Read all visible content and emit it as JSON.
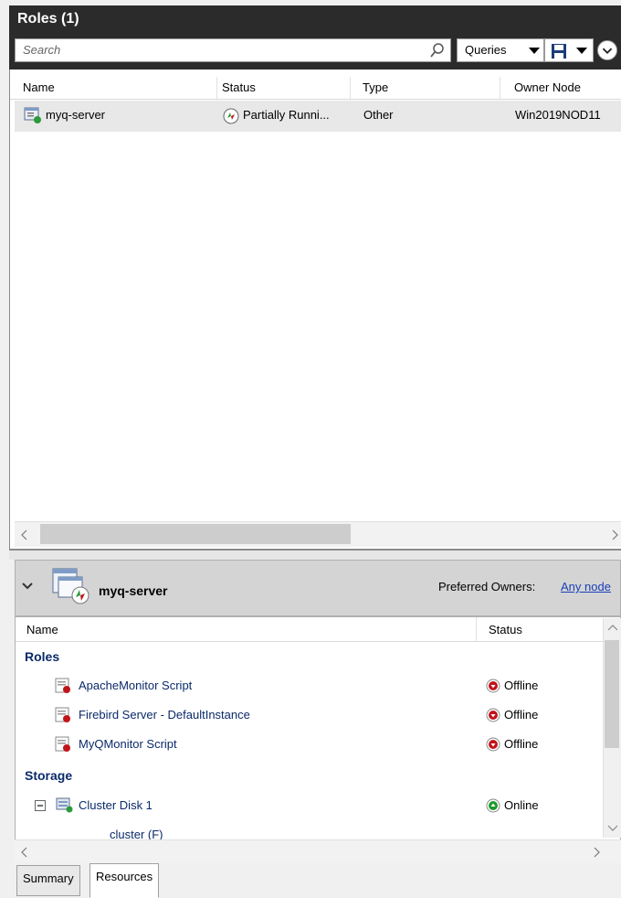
{
  "pane": {
    "title": "Roles (1)"
  },
  "search": {
    "placeholder": "Search"
  },
  "toolbar": {
    "queries_label": "Queries"
  },
  "roles_table": {
    "columns": [
      "Name",
      "Status",
      "Type",
      "Owner Node"
    ],
    "rows": [
      {
        "name": "myq-server",
        "status": "Partially Runni...",
        "type": "Other",
        "owner_node": "Win2019NOD11"
      }
    ]
  },
  "details": {
    "title": "myq-server",
    "preferred_owners_label": "Preferred Owners:",
    "preferred_owners_value": "Any node",
    "columns": [
      "Name",
      "Status"
    ],
    "groups": [
      {
        "label": "Roles",
        "items": [
          {
            "name": "ApacheMonitor Script",
            "status": "Offline"
          },
          {
            "name": "Firebird Server - DefaultInstance",
            "status": "Offline"
          },
          {
            "name": "MyQMonitor Script",
            "status": "Offline"
          }
        ]
      },
      {
        "label": "Storage",
        "items": [
          {
            "name": "Cluster Disk 1",
            "status": "Online",
            "child": "cluster (F)"
          }
        ]
      }
    ]
  },
  "tabs": [
    "Summary",
    "Resources"
  ],
  "colors": {
    "titlebar": "#2b2b2b",
    "link": "#1a3fb8",
    "offline": "#c0141c",
    "online": "#1f9a2e"
  },
  "icons": [
    "search-icon",
    "save-icon",
    "chevron-down-icon",
    "role-icon",
    "partial-running-icon",
    "script-icon",
    "offline-icon",
    "online-icon",
    "disk-icon",
    "expand-minus-icon"
  ]
}
